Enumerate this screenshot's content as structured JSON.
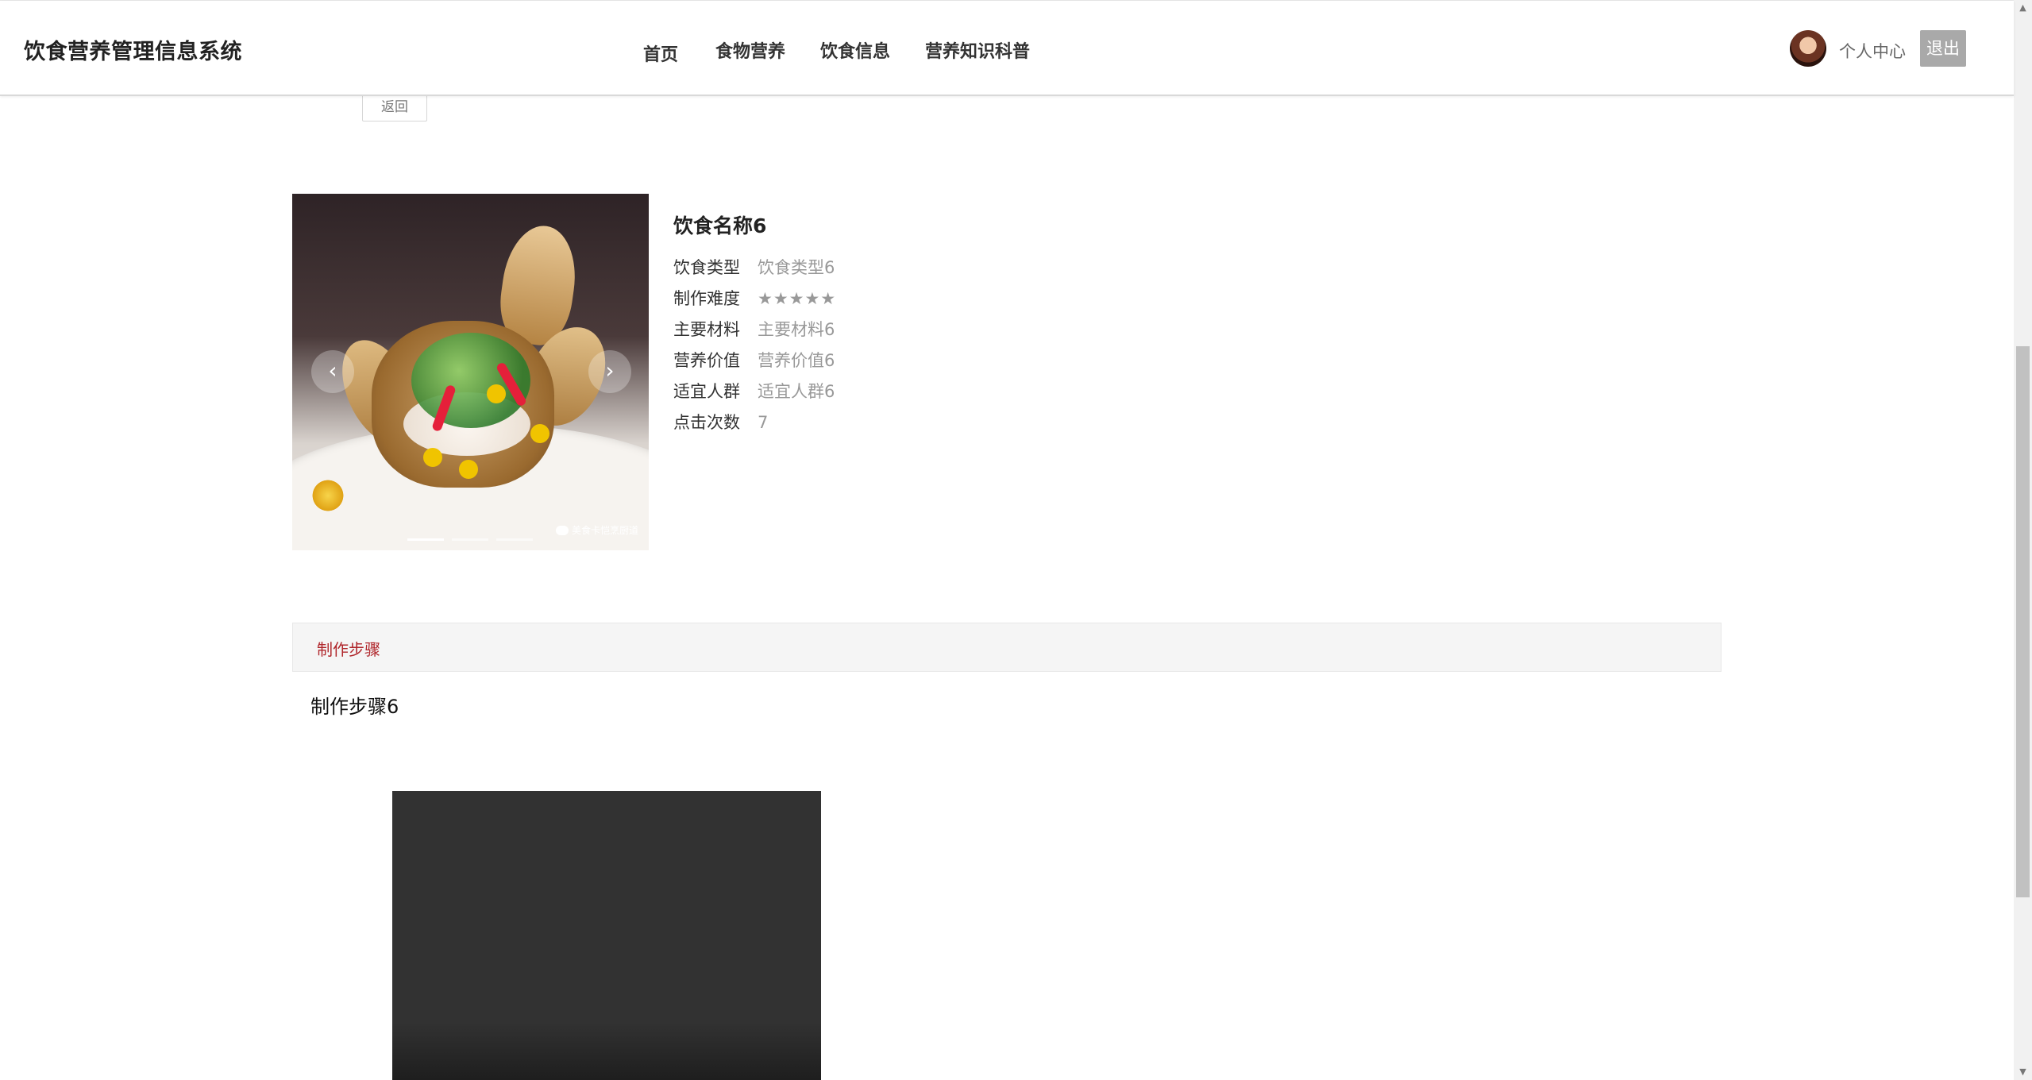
{
  "header": {
    "brand": "饮食营养管理信息系统",
    "nav": [
      "首页",
      "食物营养",
      "饮食信息",
      "营养知识科普"
    ],
    "user_center": "个人中心",
    "logout": "退出"
  },
  "back_label": "返回",
  "carousel": {
    "prev": "‹",
    "next": "›",
    "slide_count": 3,
    "active_index": 0,
    "watermark": "美食卡恺烹厨道"
  },
  "food": {
    "name": "饮食名称6",
    "fields": [
      {
        "label": "饮食类型",
        "value": "饮食类型6"
      },
      {
        "label": "制作难度",
        "value": "★★★★★"
      },
      {
        "label": "主要材料",
        "value": "主要材料6"
      },
      {
        "label": "营养价值",
        "value": "营养价值6"
      },
      {
        "label": "适宜人群",
        "value": "适宜人群6"
      },
      {
        "label": "点击次数",
        "value": "7"
      }
    ]
  },
  "steps": {
    "tab": "制作步骤",
    "content": "制作步骤6"
  },
  "colors": {
    "accent_red": "#b0262b",
    "logout_bg": "#a9a9a9",
    "video_bg": "#323232"
  }
}
